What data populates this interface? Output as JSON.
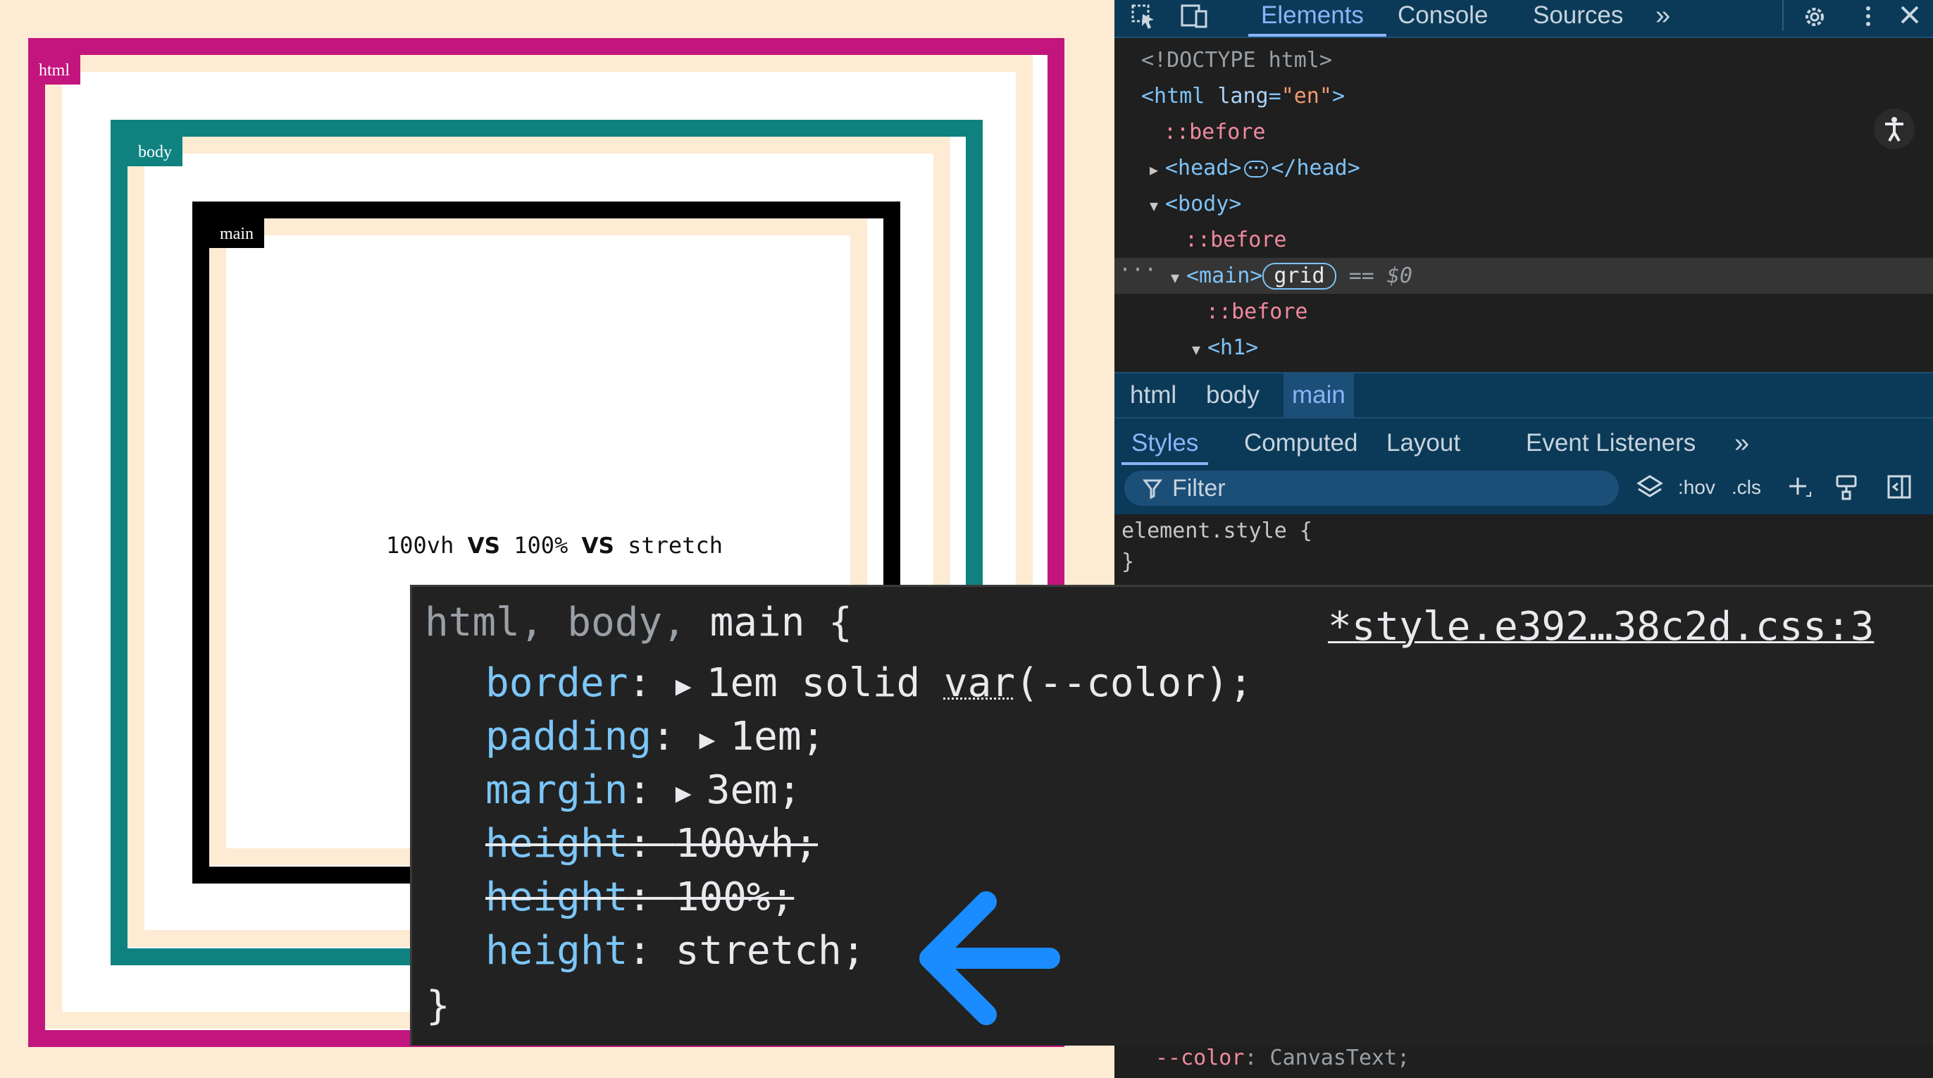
{
  "demo": {
    "tags": {
      "html": "html",
      "body": "body",
      "main": "main"
    },
    "text": {
      "part1": "100vh ",
      "vs1": "VS",
      "part2": " 100% ",
      "vs2": "VS",
      "part3": " stretch"
    },
    "colors": {
      "html": "#c2157e",
      "body": "#0f8280",
      "main": "#000000",
      "page_bg": "#fdebd3"
    }
  },
  "devtools": {
    "topbar": {
      "tabs": [
        "Elements",
        "Console",
        "Sources"
      ],
      "more": "»",
      "icons": [
        "inspect-icon",
        "device-toggle-icon",
        "more-tabs-icon",
        "settings-icon",
        "kebab-menu-icon",
        "close-icon"
      ]
    },
    "dom": {
      "doctype": "<!DOCTYPE html>",
      "html_open": "<html",
      "html_attr": "lang",
      "html_eq": "=",
      "html_val": "\"en\"",
      "html_close": ">",
      "before": "::before",
      "head_open": "<head>",
      "head_close": "</head>",
      "body_open": "<body>",
      "main_open": "<main>",
      "main_pill": "grid",
      "main_suffix": "== $0",
      "h1_open": "<h1>",
      "ellipsis": "···"
    },
    "breadcrumbs": [
      "html",
      "body",
      "main"
    ],
    "subtabs": [
      "Styles",
      "Computed",
      "Layout",
      "Event Listeners"
    ],
    "subtabs_more": "»",
    "filter": {
      "placeholder": "Filter",
      "hov": ":hov",
      "cls": ".cls"
    },
    "element_style": {
      "open": "element.style {",
      "close": "}"
    },
    "bottom_peek": {
      "prop": "--color",
      "value": ": CanvasText;"
    }
  },
  "overlay": {
    "selector_gray": "html, body, ",
    "selector_main": "main {",
    "source": "*style.e392…38c2d.css:3",
    "declarations": [
      {
        "prop": "border",
        "sep": ": ",
        "value": "1em solid ",
        "fn": "var",
        "rest": "(--color);"
      },
      {
        "prop": "padding",
        "sep": ": ",
        "value": "1em;"
      },
      {
        "prop": "margin",
        "sep": ": ",
        "value": "3em;"
      },
      {
        "prop": "height",
        "sep": ": ",
        "value": "100vh;"
      },
      {
        "prop": "height",
        "sep": ": ",
        "value": "100%;"
      },
      {
        "prop": "height",
        "sep": ": ",
        "value": "stretch;"
      }
    ],
    "close": "}",
    "arrow_color": "#1a8cff"
  }
}
